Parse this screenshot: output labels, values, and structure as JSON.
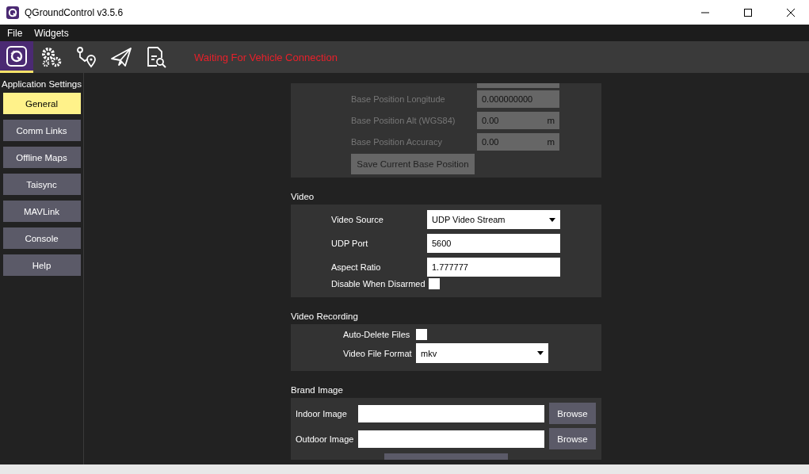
{
  "window": {
    "title": "QGroundControl v3.5.6"
  },
  "menu": [
    "File",
    "Widgets"
  ],
  "toolbar": {
    "tools": [
      {
        "kind": "app",
        "selected": true
      },
      {
        "kind": "gears",
        "selected": false
      },
      {
        "kind": "route",
        "selected": false
      },
      {
        "kind": "plane",
        "selected": false
      },
      {
        "kind": "document",
        "selected": false
      }
    ],
    "status": "Waiting For Vehicle Connection"
  },
  "sidebar": {
    "title": "Application Settings",
    "items": [
      {
        "label": "General",
        "selected": true
      },
      {
        "label": "Comm Links",
        "selected": false
      },
      {
        "label": "Offline Maps",
        "selected": false
      },
      {
        "label": "Taisync",
        "selected": false
      },
      {
        "label": "MAVLink",
        "selected": false
      },
      {
        "label": "Console",
        "selected": false
      },
      {
        "label": "Help",
        "selected": false
      }
    ]
  },
  "sections": [
    {
      "rows": [
        {
          "kind": "text",
          "label": "Base Position Longitude",
          "value": "0.000000000",
          "disabled": true
        },
        {
          "kind": "text",
          "label": "Base Position Alt (WGS84)",
          "value": "0.00",
          "unit": "m",
          "disabled": true
        },
        {
          "kind": "text",
          "label": "Base Position Accuracy",
          "value": "0.00",
          "unit": "m",
          "disabled": true
        },
        {
          "kind": "button",
          "label": "Save Current Base Position",
          "disabled": true
        }
      ]
    },
    {
      "header": "Video",
      "rows": [
        {
          "kind": "combo",
          "label": "Video Source",
          "value": "UDP Video Stream",
          "disabled": false
        },
        {
          "kind": "text",
          "label": "UDP Port",
          "value": "5600",
          "disabled": false
        },
        {
          "kind": "text",
          "label": "Aspect Ratio",
          "value": "1.777777",
          "disabled": false
        },
        {
          "kind": "checkbox",
          "label": "Disable When Disarmed",
          "checked": false,
          "disabled": false
        }
      ]
    },
    {
      "header": "Video Recording",
      "rows": [
        {
          "kind": "checkbox",
          "label": "Auto-Delete Files",
          "checked": false,
          "disabled": false
        },
        {
          "kind": "combo",
          "label": "Video File Format",
          "value": "mkv",
          "disabled": false
        }
      ]
    },
    {
      "header": "Brand Image",
      "rows": [
        {
          "kind": "file",
          "label": "Indoor Image",
          "button": "Browse",
          "disabled": false
        },
        {
          "kind": "file",
          "label": "Outdoor Image",
          "button": "Browse",
          "disabled": false
        }
      ]
    }
  ]
}
